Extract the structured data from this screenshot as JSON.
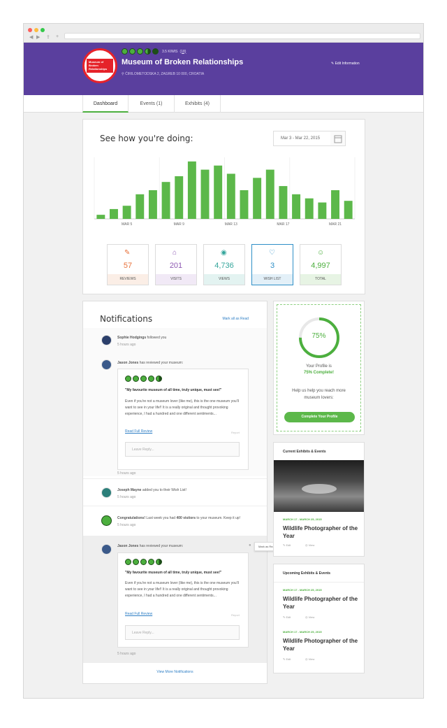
{
  "header": {
    "kiwi_count": "3.5 KIWIS",
    "review_count": "(18)",
    "title": "Museum of Broken Relationships",
    "address": "ĆIRILOMETODSKA 2, ZAGREB 10 000, CROATIA",
    "edit_label": "Edit Information",
    "logo_text": "Museum of Broken Relationships"
  },
  "tabs": [
    {
      "label": "Dashboard"
    },
    {
      "label": "Events (1)"
    },
    {
      "label": "Exhibits (4)"
    }
  ],
  "dashboard": {
    "heading": "See how you're doing:",
    "date_range": "Mar 3 - Mar 22, 2015"
  },
  "chart_data": {
    "type": "bar",
    "x": [
      "MAR 3",
      "MAR 4",
      "MAR 5",
      "MAR 6",
      "MAR 7",
      "MAR 8",
      "MAR 9",
      "MAR 10",
      "MAR 11",
      "MAR 12",
      "MAR 13",
      "MAR 14",
      "MAR 15",
      "MAR 16",
      "MAR 17",
      "MAR 18",
      "MAR 19",
      "MAR 20",
      "MAR 21",
      "MAR 22"
    ],
    "values": [
      5,
      12,
      16,
      30,
      35,
      45,
      52,
      70,
      60,
      65,
      55,
      35,
      50,
      60,
      40,
      30,
      25,
      20,
      35,
      22
    ],
    "tick_labels": [
      "MAR 5",
      "MAR 9",
      "MAR 13",
      "MAR 17",
      "MAR 21"
    ],
    "color": "#5cb84a",
    "grid": true
  },
  "stats": [
    {
      "value": "57",
      "label": "REVIEWS",
      "color": "#e8713a",
      "bg": "#fbeee6",
      "icon": "pencil-icon"
    },
    {
      "value": "201",
      "label": "VISITS",
      "color": "#8e5ab3",
      "bg": "#f1e9f6",
      "icon": "museum-icon"
    },
    {
      "value": "4,736",
      "label": "VIEWS",
      "color": "#34a59b",
      "bg": "#e3f3f1",
      "icon": "eye-icon"
    },
    {
      "value": "3",
      "label": "WISH LIST",
      "color": "#2e8fc7",
      "bg": "#e3f0f8",
      "icon": "heart-icon"
    },
    {
      "value": "4,997",
      "label": "TOTAL",
      "color": "#4caf3e",
      "bg": "#e7f4e4",
      "icon": "user-icon"
    }
  ],
  "notifications": {
    "heading": "Notifications",
    "mark_all": "Mark all as Read",
    "view_more": "View More Notifications",
    "items": [
      {
        "name": "Sophie Hodgings",
        "action": "followed you",
        "time": "5 hours ago"
      },
      {
        "name": "Jason Jones",
        "action": "has reviewed your museum:",
        "time": "5 hours ago"
      },
      {
        "name": "Joseph Mayne",
        "action": "added you to their Wish List!",
        "time": "5 hours ago"
      },
      {
        "strong": "Congratulations!",
        "text1": "Last week you had",
        "highlight": "400 visitors",
        "text2": "to your museum. Keep it up!",
        "time": "5 hours ago"
      },
      {
        "name": "Jason Jones",
        "action": "has reviewed your museum:",
        "time": "5 hours ago"
      }
    ],
    "review": {
      "quote": "\"My favourite museum of all time, truly unique, must see!\"",
      "body": "Even if you're not a museum lover (like me), this is the one museum you'll want to see in your life!! It is a really original and thought provoking experience, I had a hundred and one different sentiments...",
      "link": "Read Full Review",
      "report": "Report",
      "reply_placeholder": "Leave Reply..."
    },
    "tooltip": "Mark as Read"
  },
  "profile": {
    "percent_label": "75%",
    "percent": 0.75,
    "line1": "Your Profile is",
    "line2": "75% Complete!",
    "help": "Help us help you reach more museum lovers:",
    "button": "Complete Your Profile"
  },
  "current": {
    "heading": "Current Exhibits & Events",
    "date": "MARCH 17 - MARCH 25, 2015",
    "title": "Wildlife Photographer of the Year",
    "edit": "Edit",
    "view": "View"
  },
  "upcoming": {
    "heading": "Upcoming Exhibits & Events",
    "items": [
      {
        "date": "MARCH 17 - MARCH 25, 2015",
        "title": "Wildlife Photographer of the Year",
        "edit": "Edit",
        "view": "View"
      },
      {
        "date": "MARCH 17 - MARCH 25, 2015",
        "title": "Wildlife Photographer of the Year",
        "edit": "Edit",
        "view": "View"
      }
    ]
  }
}
